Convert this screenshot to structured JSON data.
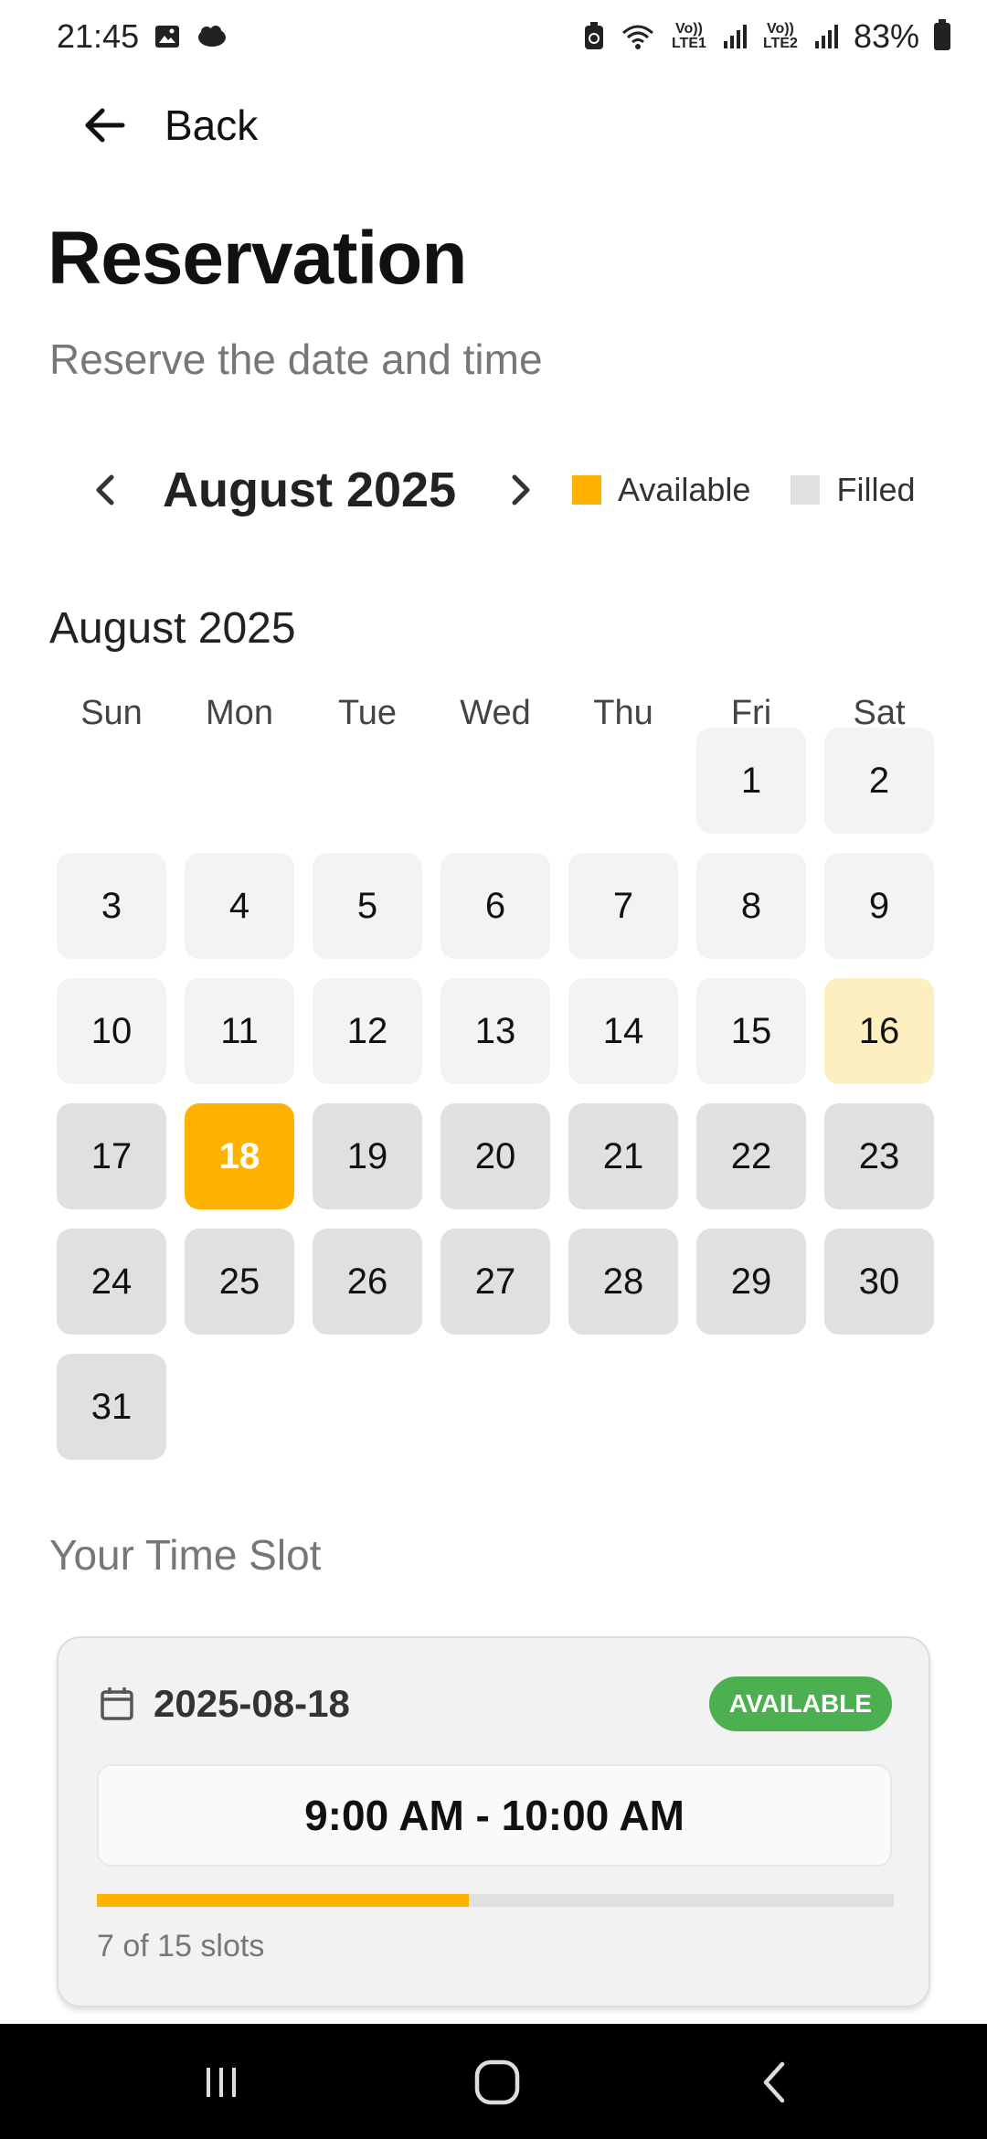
{
  "status_bar": {
    "time": "21:45",
    "battery": "83%",
    "sim1": "Vo)) LTE1",
    "sim2": "Vo)) LTE2",
    "icons": [
      "image-icon",
      "cloud-icon",
      "battery-saver-icon",
      "wifi-icon",
      "signal-icon",
      "battery-icon"
    ]
  },
  "header": {
    "back_label": "Back",
    "title": "Reservation",
    "subtitle": "Reserve the date and time"
  },
  "month_nav": {
    "label": "August 2025"
  },
  "legend": [
    {
      "label": "Available",
      "color": "#ffb300"
    },
    {
      "label": "Filled",
      "color": "#e0e0e0"
    }
  ],
  "calendar": {
    "title": "August 2025",
    "weekdays": [
      "Sun",
      "Mon",
      "Tue",
      "Wed",
      "Thu",
      "Fri",
      "Sat"
    ],
    "first_weekday_index": 5,
    "days": [
      {
        "n": "1",
        "state": "open"
      },
      {
        "n": "2",
        "state": "open"
      },
      {
        "n": "3",
        "state": "open"
      },
      {
        "n": "4",
        "state": "open"
      },
      {
        "n": "5",
        "state": "open"
      },
      {
        "n": "6",
        "state": "open"
      },
      {
        "n": "7",
        "state": "open"
      },
      {
        "n": "8",
        "state": "open"
      },
      {
        "n": "9",
        "state": "open"
      },
      {
        "n": "10",
        "state": "open"
      },
      {
        "n": "11",
        "state": "open"
      },
      {
        "n": "12",
        "state": "open"
      },
      {
        "n": "13",
        "state": "open"
      },
      {
        "n": "14",
        "state": "open"
      },
      {
        "n": "15",
        "state": "open"
      },
      {
        "n": "16",
        "state": "partial"
      },
      {
        "n": "17",
        "state": "filled"
      },
      {
        "n": "18",
        "state": "selected"
      },
      {
        "n": "19",
        "state": "filled"
      },
      {
        "n": "20",
        "state": "filled"
      },
      {
        "n": "21",
        "state": "filled"
      },
      {
        "n": "22",
        "state": "filled"
      },
      {
        "n": "23",
        "state": "filled"
      },
      {
        "n": "24",
        "state": "filled"
      },
      {
        "n": "25",
        "state": "filled"
      },
      {
        "n": "26",
        "state": "filled"
      },
      {
        "n": "27",
        "state": "filled"
      },
      {
        "n": "28",
        "state": "filled"
      },
      {
        "n": "29",
        "state": "filled"
      },
      {
        "n": "30",
        "state": "filled"
      },
      {
        "n": "31",
        "state": "filled"
      }
    ]
  },
  "time_slot": {
    "heading": "Your Time Slot",
    "date": "2025-08-18",
    "badge": "AVAILABLE",
    "time_range": "9:00 AM - 10:00 AM",
    "booked": 7,
    "total": 15,
    "slots_text": "7 of 15 slots"
  },
  "colors": {
    "accent": "#ffb300",
    "available_badge": "#4caf50",
    "filled": "#e0e0e0",
    "open": "#f3f3f3",
    "partial": "#fdefbf"
  }
}
